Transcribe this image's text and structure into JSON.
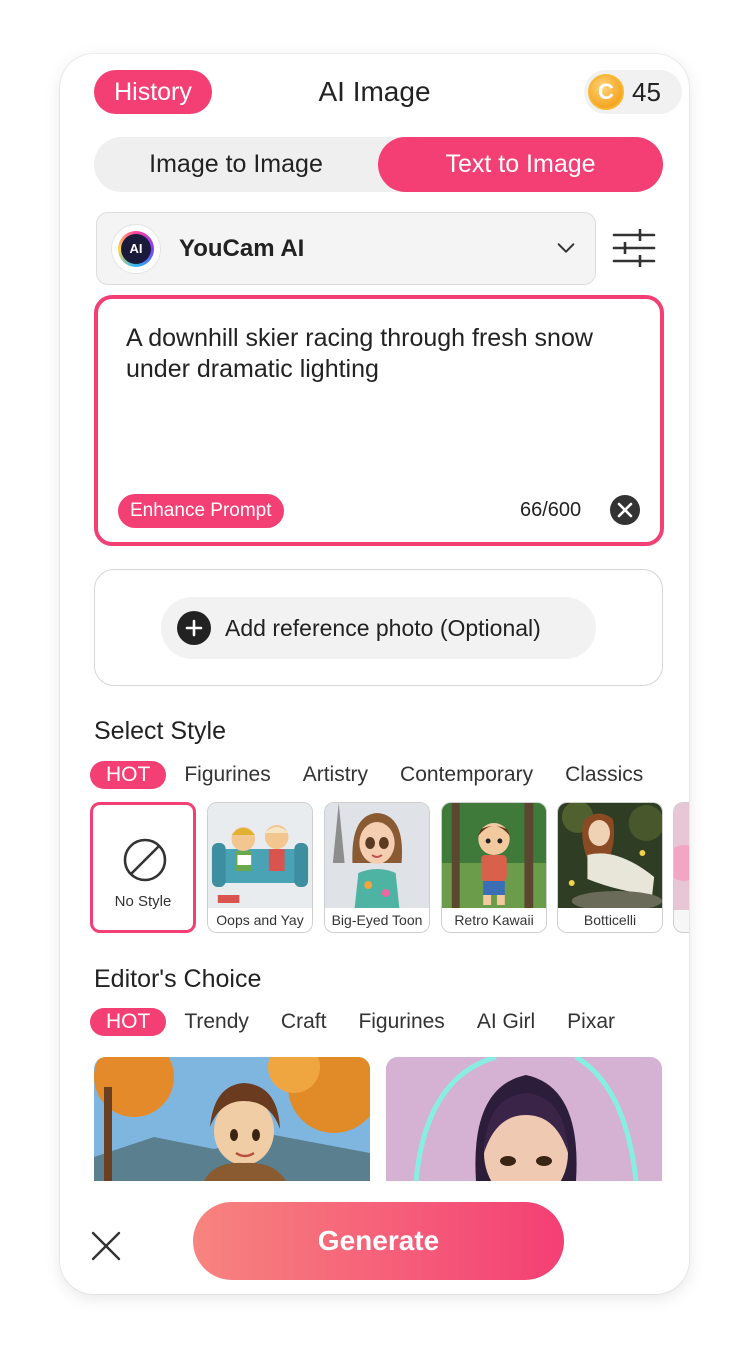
{
  "header": {
    "history_label": "History",
    "title": "AI Image",
    "coin_symbol": "C",
    "coin_count": "45"
  },
  "mode_toggle": {
    "left_label": "Image to Image",
    "right_label": "Text to Image",
    "selected": "Text to Image"
  },
  "model": {
    "logo_text": "AI",
    "name": "YouCam AI"
  },
  "prompt": {
    "text": "A downhill skier racing through fresh snow under dramatic lighting",
    "enhance_label": "Enhance Prompt",
    "char_count": "66/600"
  },
  "reference": {
    "label": "Add reference photo (Optional)"
  },
  "select_style": {
    "title": "Select Style",
    "tabs": [
      "HOT",
      "Figurines",
      "Artistry",
      "Contemporary",
      "Classics"
    ],
    "items": [
      {
        "label": "No Style",
        "selected": true
      },
      {
        "label": "Oops and Yay"
      },
      {
        "label": "Big-Eyed Toon"
      },
      {
        "label": "Retro Kawaii"
      },
      {
        "label": "Botticelli"
      }
    ]
  },
  "editors_choice": {
    "title": "Editor's Choice",
    "tabs": [
      "HOT",
      "Trendy",
      "Craft",
      "Figurines",
      "AI Girl",
      "Pixar"
    ]
  },
  "footer": {
    "generate_label": "Generate"
  },
  "colors": {
    "accent": "#f43f74",
    "gradient_start": "#f7847f"
  }
}
